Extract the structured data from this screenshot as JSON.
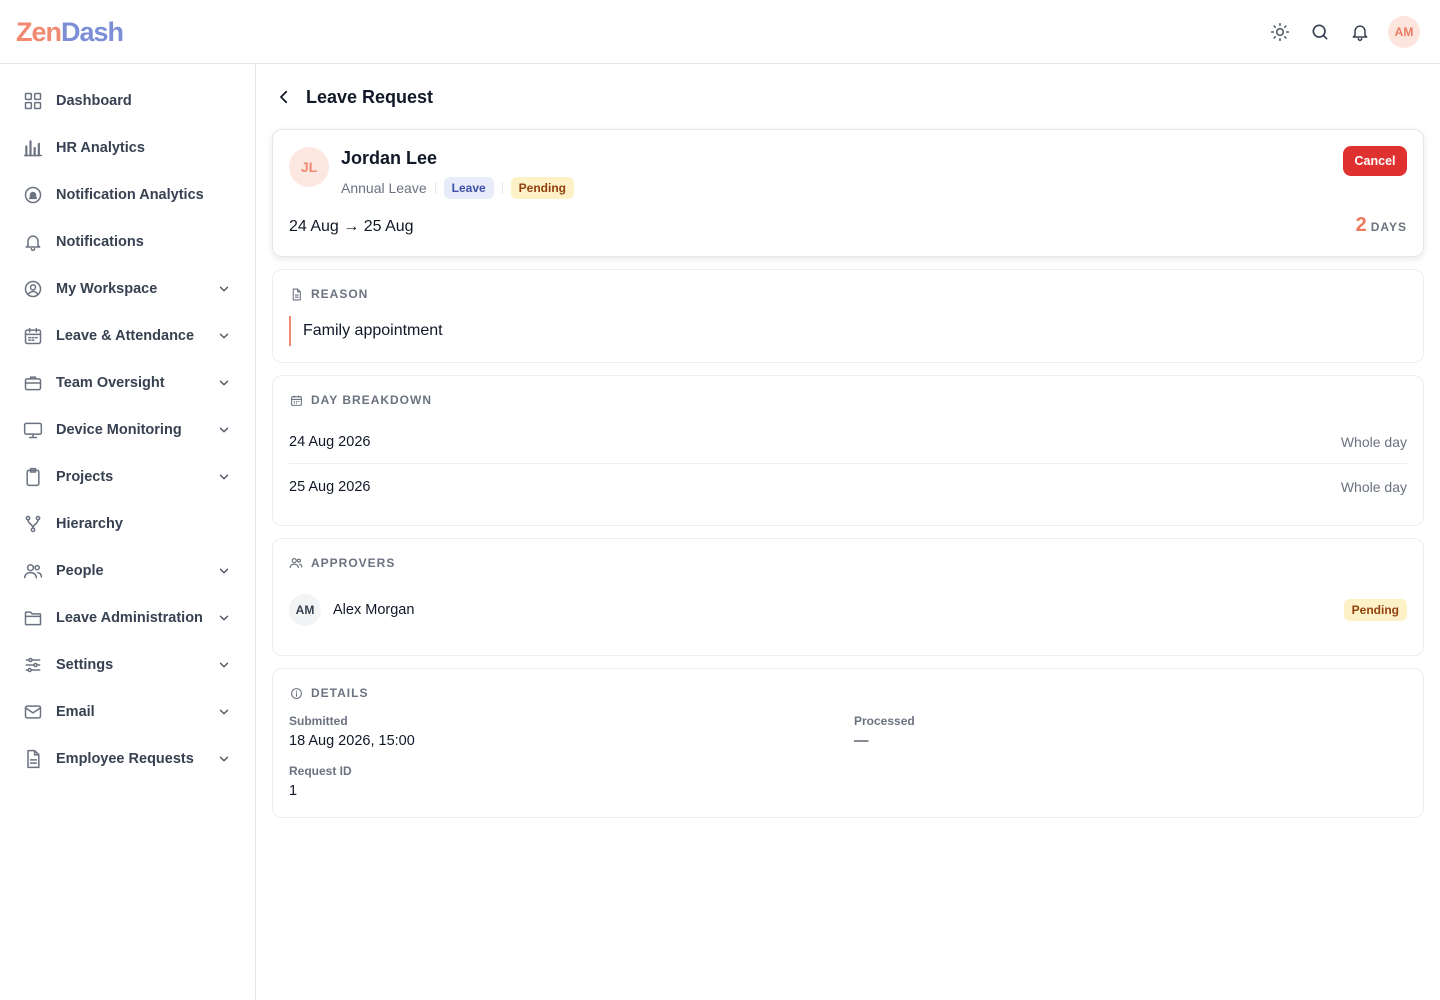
{
  "app": {
    "logo_part1": "Zen",
    "logo_part2": "Dash",
    "user_initials": "AM"
  },
  "topbar": {
    "icons": [
      "sun-icon",
      "search-icon",
      "bell-icon"
    ]
  },
  "sidebar": {
    "items": [
      {
        "label": "Dashboard",
        "icon": "grid-icon",
        "expandable": false
      },
      {
        "label": "HR Analytics",
        "icon": "bar-chart-icon",
        "expandable": false
      },
      {
        "label": "Notification Analytics",
        "icon": "bell-circle-icon",
        "expandable": false
      },
      {
        "label": "Notifications",
        "icon": "bell-icon",
        "expandable": false
      },
      {
        "label": "My Workspace",
        "icon": "user-circle-icon",
        "expandable": true
      },
      {
        "label": "Leave & Attendance",
        "icon": "calendar-icon",
        "expandable": true
      },
      {
        "label": "Team Oversight",
        "icon": "briefcase-icon",
        "expandable": true
      },
      {
        "label": "Device Monitoring",
        "icon": "monitor-icon",
        "expandable": true
      },
      {
        "label": "Projects",
        "icon": "clipboard-icon",
        "expandable": true
      },
      {
        "label": "Hierarchy",
        "icon": "hierarchy-icon",
        "expandable": false
      },
      {
        "label": "People",
        "icon": "people-icon",
        "expandable": true
      },
      {
        "label": "Leave Administration",
        "icon": "folder-icon",
        "expandable": true
      },
      {
        "label": "Settings",
        "icon": "sliders-icon",
        "expandable": true
      },
      {
        "label": "Email",
        "icon": "mail-icon",
        "expandable": true
      },
      {
        "label": "Employee Requests",
        "icon": "document-icon",
        "expandable": true
      }
    ]
  },
  "page": {
    "title": "Leave Request"
  },
  "request": {
    "employee_initials": "JL",
    "employee_name": "Jordan Lee",
    "leave_type": "Annual Leave",
    "category_chip": "Leave",
    "status_chip": "Pending",
    "cancel_label": "Cancel",
    "date_range": "24 Aug → 25 Aug",
    "days_count": "2",
    "days_unit": "DAYS"
  },
  "reason": {
    "heading": "REASON",
    "text": "Family appointment"
  },
  "breakdown": {
    "heading": "DAY BREAKDOWN",
    "rows": [
      {
        "date": "24 Aug 2026",
        "kind": "Whole day"
      },
      {
        "date": "25 Aug 2026",
        "kind": "Whole day"
      }
    ]
  },
  "approvers": {
    "heading": "APPROVERS",
    "items": [
      {
        "initials": "AM",
        "name": "Alex Morgan",
        "status": "Pending"
      }
    ]
  },
  "details": {
    "heading": "DETAILS",
    "submitted_label": "Submitted",
    "submitted_value": "18 Aug 2026, 15:00",
    "processed_label": "Processed",
    "processed_value": "—",
    "request_id_label": "Request ID",
    "request_id_value": "1"
  },
  "colors": {
    "accent": "#ec7a5c",
    "danger": "#e03131",
    "pending_bg": "#fdf1c7",
    "leave_chip_bg": "#e8ebfa"
  }
}
